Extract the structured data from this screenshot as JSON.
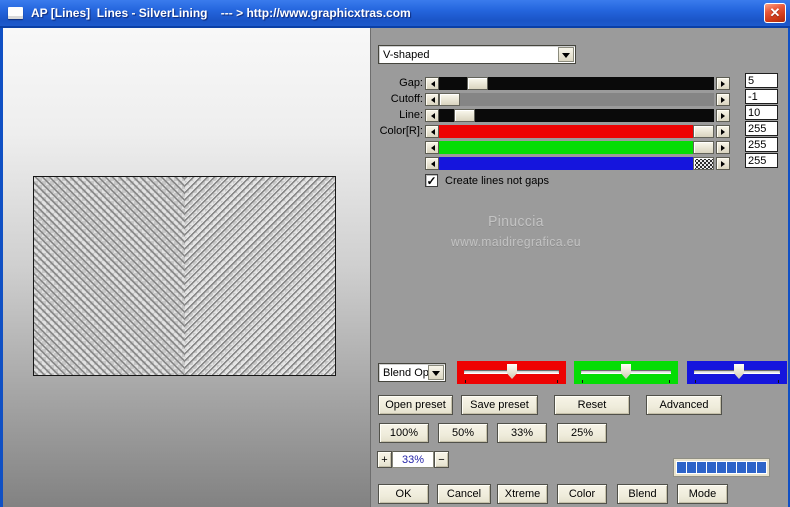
{
  "window": {
    "title": "AP [Lines]  Lines - SilverLining    --- > http://www.graphicxtras.com"
  },
  "icons": {
    "close": "✕",
    "check": "✓",
    "dropdown_arrow": "combo-down-arrow",
    "slider_arrows": "left-right-step-arrows"
  },
  "colors": {
    "titlebar_blue": "#1d5cd6",
    "panel_gray": "#9b9b9b",
    "button_cream": "#f1eedd",
    "progress_blue": "#2e64c8",
    "watermark_gray": "#c3c3c3"
  },
  "controls": {
    "pattern_select": {
      "value": "V-shaped"
    },
    "sliders": [
      {
        "label": "Gap:",
        "value": "5",
        "track_color": "#0a0a0a",
        "thumb_frac": 0.11,
        "thumb_checkered": false
      },
      {
        "label": "Cutoff:",
        "value": "-1",
        "track_color": "#858585",
        "thumb_frac": 0.0,
        "thumb_checkered": false
      },
      {
        "label": "Line:",
        "value": "10",
        "track_color": "#0a0a0a",
        "thumb_frac": 0.06,
        "thumb_checkered": false
      },
      {
        "label": "Color[R]:",
        "value": "255",
        "track_color": "#ee0202",
        "thumb_frac": 1.0,
        "thumb_checkered": false
      },
      {
        "label": "",
        "value": "255",
        "track_color": "#04dd04",
        "thumb_frac": 1.0,
        "thumb_checkered": false
      },
      {
        "label": "",
        "value": "255",
        "track_color": "#1515dd",
        "thumb_frac": 1.0,
        "thumb_checkered": true
      }
    ],
    "checkbox": {
      "label": "Create lines not gaps",
      "checked": true
    },
    "blend_select": {
      "value": "Blend Opti"
    },
    "channel_trackbars": [
      {
        "name": "red",
        "color": "#ee0202",
        "thumb_frac": 0.5
      },
      {
        "name": "green",
        "color": "#04dd04",
        "thumb_frac": 0.5
      },
      {
        "name": "blue",
        "color": "#1515dd",
        "thumb_frac": 0.52
      }
    ],
    "preset_buttons": [
      "Open preset",
      "Save preset",
      "Reset",
      "Advanced"
    ],
    "percent_buttons": [
      "100%",
      "50%",
      "33%",
      "25%"
    ],
    "zoom_control": {
      "plus": "+",
      "value": "33%",
      "minus": "−"
    },
    "progress": {
      "segments": 9,
      "color": "#2e64c8"
    },
    "action_buttons": [
      "OK",
      "Cancel",
      "Xtreme",
      "Color",
      "Blend",
      "Mode"
    ]
  },
  "watermark": {
    "line1": "Pinuccia",
    "line2": "www.maidiregrafica.eu"
  }
}
